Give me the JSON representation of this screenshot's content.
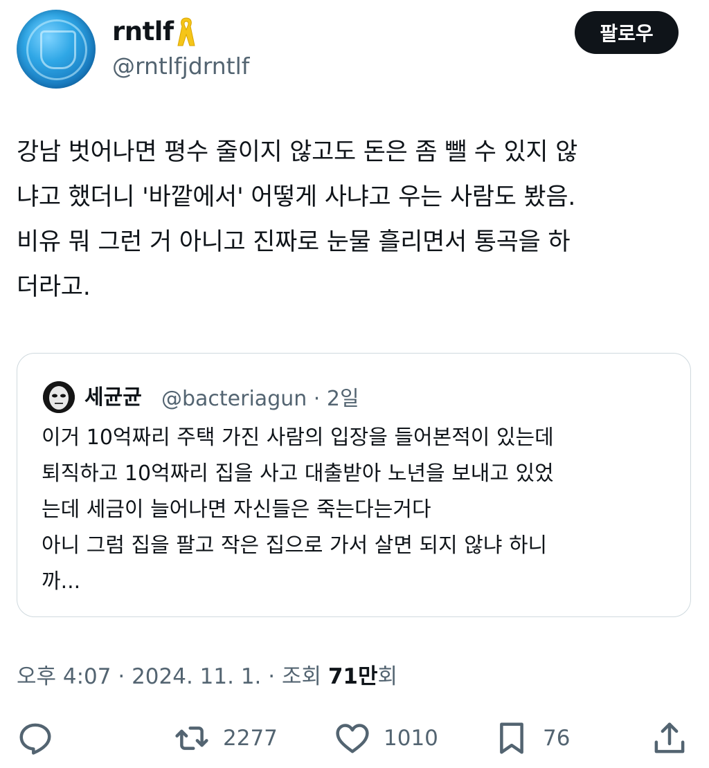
{
  "author": {
    "display_name": "rntlf",
    "handle": "@rntlfjdrntlf"
  },
  "follow_label": "팔로우",
  "tweet_text": "강남 벗어나면 평수 줄이지 않고도 돈은 좀 뺄 수 있지 않\n냐고 했더니 '바깥에서' 어떻게 사냐고 우는 사람도 봤음.\n비유 뭐 그런 거 아니고 진짜로 눈물 흘리면서 통곡을 하\n더라고.",
  "quote": {
    "display_name": "세균균",
    "handle_time": "@bacteriagun · 2일",
    "text": "이거 10억짜리 주택 가진 사람의 입장을 들어본적이 있는데\n퇴직하고 10억짜리 집을 사고 대출받아 노년을 보내고 있었\n는데 세금이 늘어나면 자신들은 죽는다는거다\n아니 그럼 집을 팔고 작은 집으로 가서 살면 되지 않냐 하니\n까..."
  },
  "meta": {
    "timestamp": "오후 4:07 · 2024. 11. 1. · 조회 ",
    "views_count": "71만",
    "views_suffix": "회"
  },
  "actions": {
    "reply_icon": "reply-icon",
    "retweet_count": "2277",
    "like_count": "1010",
    "bookmark_count": "76",
    "share_icon": "share-icon"
  },
  "colors": {
    "text": "#0f1419",
    "secondary": "#536471",
    "border": "#cfd9de",
    "ribbon": "#f5c518"
  }
}
